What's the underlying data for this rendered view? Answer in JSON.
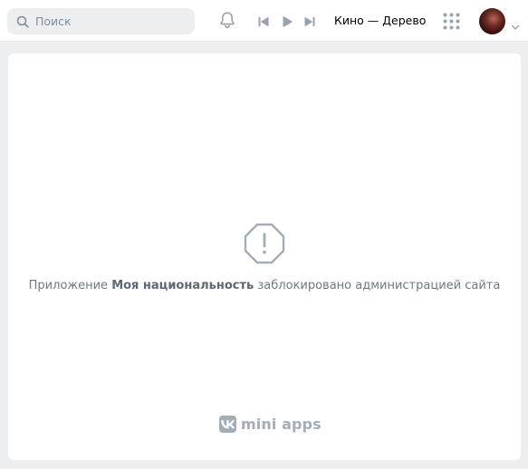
{
  "header": {
    "search": {
      "placeholder": "Поиск",
      "value": ""
    },
    "player": {
      "track_title": "Кино — Дерево"
    }
  },
  "main": {
    "message_prefix": "Приложение ",
    "app_name": "Моя национальность",
    "message_suffix": " заблокировано администрацией сайта",
    "brand_text": "mini apps"
  },
  "icons": {
    "search": "search-icon",
    "bell": "bell-icon",
    "prev": "previous-track-icon",
    "play": "play-icon",
    "next": "next-track-icon",
    "apps": "apps-grid-icon",
    "chevron": "chevron-down-icon",
    "warning": "warning-octagon-icon",
    "vk": "vk-logo-icon"
  },
  "colors": {
    "page_background": "#edeef0",
    "header_background": "#ffffff",
    "icon_gray": "#99a2ad",
    "text_secondary": "#6d7885",
    "brand_gray": "#a3adb8"
  }
}
